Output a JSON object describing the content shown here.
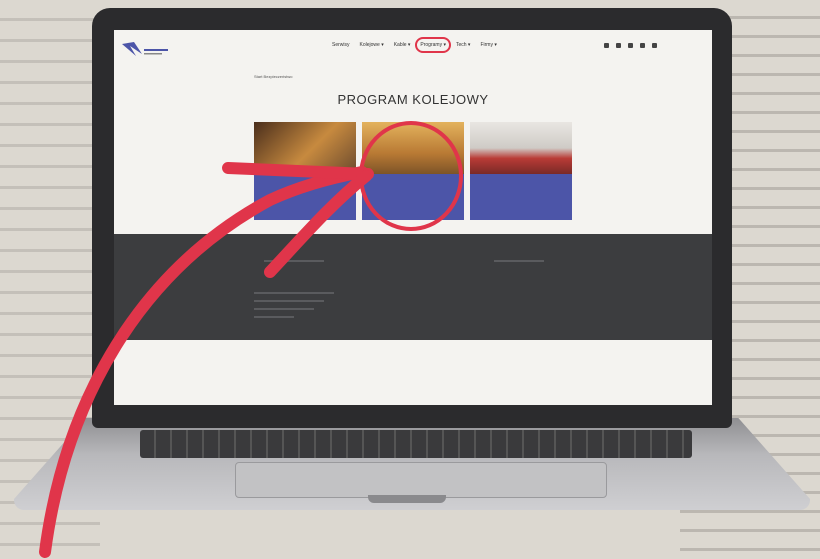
{
  "site": {
    "nav": [
      {
        "label": "Serwisy"
      },
      {
        "label": "Kolejowe ▾"
      },
      {
        "label": "Kable ▾"
      },
      {
        "label": "Programy ▾"
      },
      {
        "label": "Tech ▾"
      },
      {
        "label": "Firmy ▾"
      }
    ],
    "breadcrumb": "Start  Bezpieczeństwo",
    "title": "PROGRAM KOLEJOWY",
    "cards": [
      {
        "text": ""
      },
      {
        "text": ""
      },
      {
        "text": ""
      }
    ]
  },
  "colors": {
    "annotation": "#e0354a",
    "card_blue": "#4c55a8",
    "footer_dark": "#3c3d3f"
  },
  "icons": [
    "logo-bird-icon",
    "social-icon",
    "arrow-annotation-icon"
  ]
}
